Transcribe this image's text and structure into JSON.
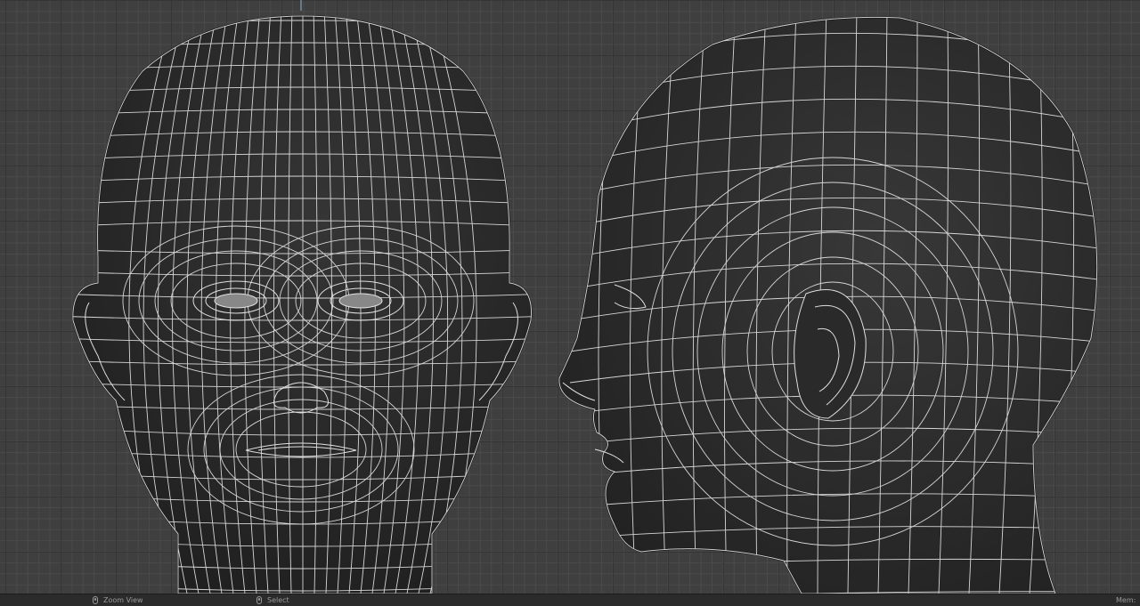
{
  "viewport": {
    "name": "3D viewport",
    "grid_visible": true,
    "views": [
      "front",
      "side"
    ]
  },
  "statusbar": {
    "zoom_hint": {
      "icon": "mouse-middle-icon",
      "label": "Zoom View"
    },
    "select_hint": {
      "icon": "mouse-left-icon",
      "label": "Select"
    },
    "memory_label": "Mem:"
  },
  "colors": {
    "grid_bg": "#3f3f3f",
    "mesh_fill": "#262626",
    "wire": "#d9d9d9",
    "statusbar_bg": "#2b2b2b"
  }
}
